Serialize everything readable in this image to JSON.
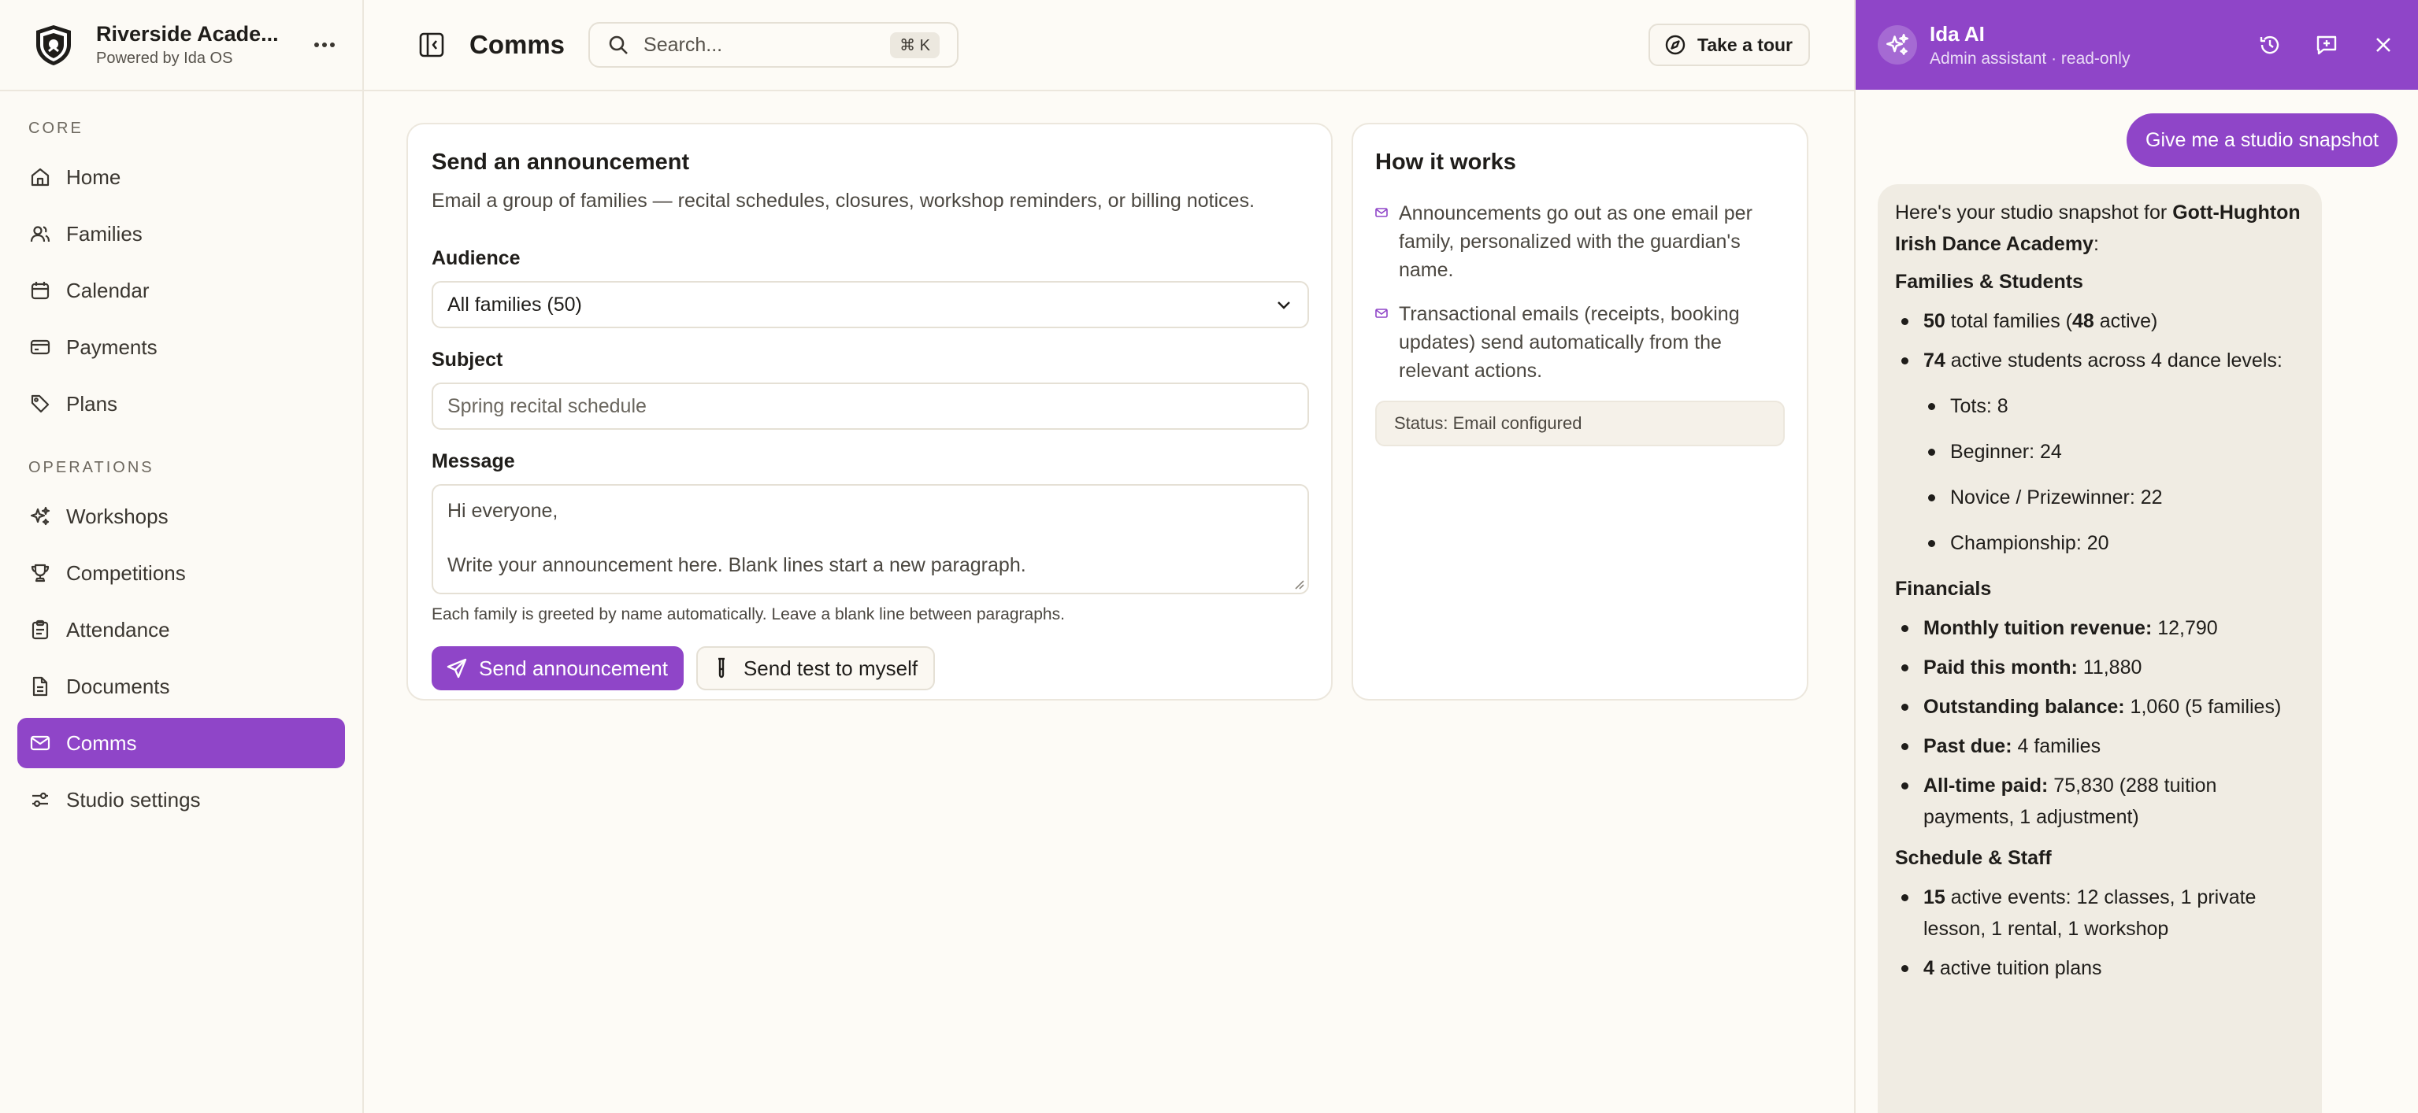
{
  "brand": {
    "name": "Riverside Acade...",
    "subtitle": "Powered by Ida OS"
  },
  "sidebar": {
    "core_label": "CORE",
    "core_items": [
      {
        "label": "Home",
        "icon": "home-icon"
      },
      {
        "label": "Families",
        "icon": "users-icon"
      },
      {
        "label": "Calendar",
        "icon": "calendar-icon"
      },
      {
        "label": "Payments",
        "icon": "credit-card-icon"
      },
      {
        "label": "Plans",
        "icon": "tag-icon"
      }
    ],
    "ops_label": "OPERATIONS",
    "ops_items": [
      {
        "label": "Workshops",
        "icon": "sparkles-icon"
      },
      {
        "label": "Competitions",
        "icon": "trophy-icon"
      },
      {
        "label": "Attendance",
        "icon": "clipboard-icon"
      },
      {
        "label": "Documents",
        "icon": "document-icon"
      },
      {
        "label": "Comms",
        "icon": "mail-icon",
        "active": true
      },
      {
        "label": "Studio settings",
        "icon": "sliders-icon"
      }
    ]
  },
  "topbar": {
    "title": "Comms",
    "search_placeholder": "Search...",
    "search_shortcut": "⌘ K",
    "tour_label": "Take a tour"
  },
  "announce": {
    "title": "Send an announcement",
    "description": "Email a group of families — recital schedules, closures, workshop reminders, or billing notices.",
    "audience_label": "Audience",
    "audience_value": "All families (50)",
    "subject_label": "Subject",
    "subject_placeholder": "Spring recital schedule",
    "message_label": "Message",
    "message_line1": "Hi everyone,",
    "message_line2": "Write your announcement here. Blank lines start a new paragraph.",
    "helper": "Each family is greeted by name automatically. Leave a blank line between paragraphs.",
    "send_label": "Send announcement",
    "test_label": "Send test to myself"
  },
  "how": {
    "title": "How it works",
    "items": [
      "Announcements go out as one email per family, personalized with the guardian's name.",
      "Transactional emails (receipts, booking updates) send automatically from the relevant actions."
    ],
    "status": "Status: Email configured"
  },
  "assistant": {
    "name": "Ida AI",
    "subtitle": "Admin assistant · read-only",
    "user_message": "Give me a studio snapshot",
    "intro_prefix": "Here's your studio snapshot for ",
    "intro_studio": "Gott-Hughton Irish Dance Academy",
    "intro_suffix": ":",
    "families_heading": "Families & Students",
    "families_total": "50",
    "families_total_mid": " total families (",
    "families_active": "48",
    "families_active_suffix": " active)",
    "students_count": "74",
    "students_text": " active students across 4 dance levels:",
    "levels": [
      "Tots: 8",
      "Beginner: 24",
      "Novice / Prizewinner: 22",
      "Championship: 20"
    ],
    "financials_heading": "Financials",
    "financials": [
      {
        "label": "Monthly tuition revenue:",
        "value": " 12,790"
      },
      {
        "label": "Paid this month:",
        "value": " 11,880"
      },
      {
        "label": "Outstanding balance:",
        "value": " 1,060 (5 families)"
      },
      {
        "label": "Past due:",
        "value": " 4 families"
      },
      {
        "label": "All-time paid:",
        "value": " 75,830 (288 tuition payments, 1 adjustment)"
      }
    ],
    "schedule_heading": "Schedule & Staff",
    "events_count": "15",
    "events_text": " active events: 12 classes, 1 private lesson, 1 rental, 1 workshop",
    "plans_count": "4",
    "plans_text": " active tuition plans"
  },
  "colors": {
    "accent": "#8f45c8",
    "background": "#fdfbf6",
    "card_border": "#ece7dd"
  }
}
